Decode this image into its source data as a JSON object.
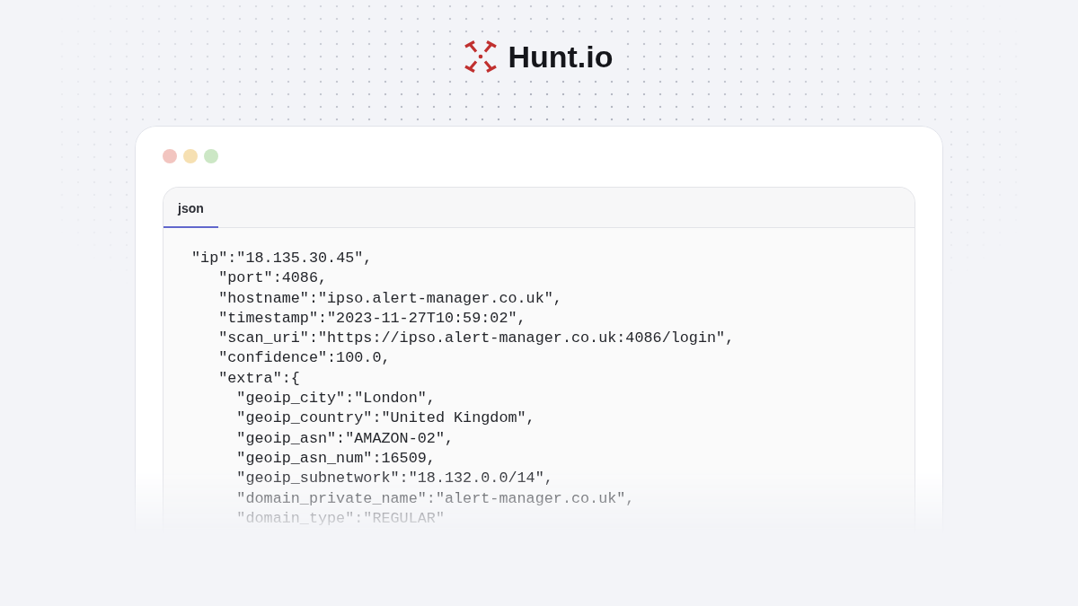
{
  "logo": {
    "text": "Hunt.io"
  },
  "window": {
    "controls": [
      {
        "color": "#f2c5c0"
      },
      {
        "color": "#f6e0b2"
      },
      {
        "color": "#cce7c5"
      }
    ]
  },
  "tabs": [
    {
      "label": "json",
      "selected": true
    }
  ],
  "code_lines": [
    {
      "text": "\"ip\":\"18.135.30.45\",",
      "children": [
        {
          "text": "\"port\":4086,"
        },
        {
          "text": "\"hostname\":\"ipso.alert-manager.co.uk\","
        },
        {
          "text": "\"timestamp\":\"2023-11-27T10:59:02\","
        },
        {
          "text": "\"scan_uri\":\"https://ipso.alert-manager.co.uk:4086/login\","
        },
        {
          "text": "\"confidence\":100.0,"
        },
        {
          "text": "\"extra\":{",
          "children": [
            {
              "text": "\"geoip_city\":\"London\","
            },
            {
              "text": "\"geoip_country\":\"United Kingdom\","
            },
            {
              "text": "\"geoip_asn\":\"AMAZON-02\","
            },
            {
              "text": "\"geoip_asn_num\":16509,"
            },
            {
              "text": "\"geoip_subnetwork\":\"18.132.0.0/14\","
            },
            {
              "text": "\"domain_private_name\":\"alert-manager.co.uk\","
            },
            {
              "text": "\"domain_type\":\"REGULAR\""
            }
          ]
        }
      ]
    }
  ]
}
